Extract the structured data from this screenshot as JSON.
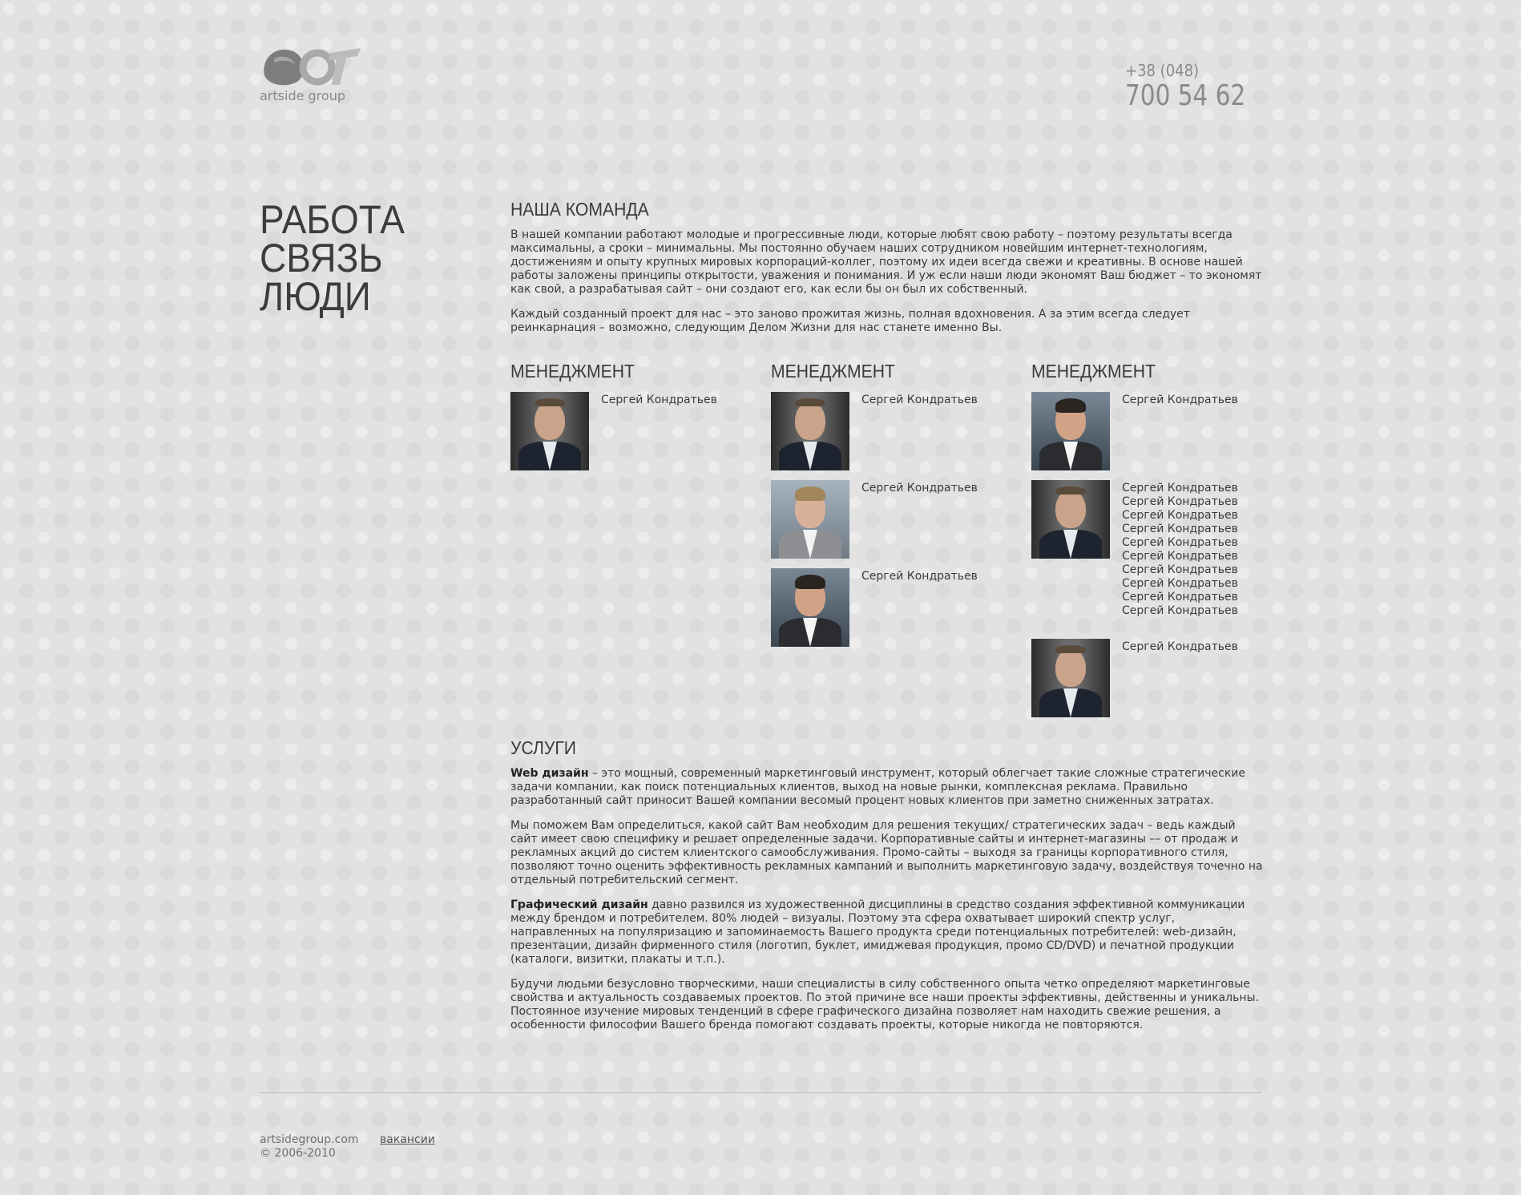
{
  "header": {
    "logo_text": "artside group",
    "phone_code": "+38 (048)",
    "phone_number": "700 54 62"
  },
  "slogan": [
    "РАБОТА",
    "СВЯЗЬ",
    "ЛЮДИ"
  ],
  "team_intro": {
    "title": "НАША КОМАНДА",
    "paragraphs": [
      "В нашей компании работают молодые и прогрессивные люди, которые любят свою работу – поэтому результаты всегда максимальны, а сроки – минимальны. Мы постоянно обучаем наших сотрудником новейшим интернет-технологиям, достижениям и опыту крупных мировых корпораций-коллег, поэтому их идеи всегда свежи и креативны. В основе нашей работы заложены принципы открытости, уважения и понимания. И уж если наши люди экономят Ваш бюджет – то экономят как свой, а разрабатывая сайт – они создают его, как если бы он был их собственный.",
      "Каждый созданный проект для нас – это заново прожитая жизнь, полная вдохновения. А за этим всегда следует реинкарнация – возможно, следующим Делом Жизни для нас станете именно Вы."
    ]
  },
  "team_columns": [
    {
      "title": "МЕНЕДЖМЕНТ",
      "people": [
        {
          "name": "Сергей Кондратьев",
          "photo": "man-bald-beard"
        }
      ]
    },
    {
      "title": "МЕНЕДЖМЕНТ",
      "people": [
        {
          "name": "Сергей Кондратьев",
          "photo": "man-bald-beard"
        },
        {
          "name": "Сергей Кондратьев",
          "photo": "man-blond"
        },
        {
          "name": "Сергей Кондратьев",
          "photo": "man-dark-hair"
        }
      ]
    },
    {
      "title": "МЕНЕДЖМЕНТ",
      "people": [
        {
          "name": "Сергей Кондратьев",
          "photo": "man-dark-hair"
        },
        {
          "name": "Сергей КондратьевСергей КондратьевСергей КондратьевСергей КондратьевСергей КондратьевСергей КондратьевСергей КондратьевСергей КондратьевСергей КондратьевСергей Кондратьев",
          "photo": "man-bald-beard"
        },
        {
          "name": "Сергей Кондратьев",
          "photo": "man-bald-beard"
        }
      ]
    }
  ],
  "services": {
    "title": "УСЛУГИ",
    "web_design_bold": "Web дизайн",
    "web_design_text": " – это мощный, современный маркетинговый инструмент, который облегчает такие сложные стратегические задачи компании, как поиск потенциальных клиентов, выход на новые рынки, комплексная реклама. Правильно разработанный сайт приносит Вашей компании весомый процент новых клиентов при заметно сниженных затратах.",
    "paragraph2": "Мы поможем Вам определиться, какой сайт Вам необходим для решения текущих/ стратегических задач – ведь каждый сайт имеет свою специфику и решает определенные задачи. Корпоративные сайты и интернет-магазины –– от продаж и рекламных акций до систем клиентского самообслуживания. Промо-сайты – выходя за границы корпоративного стиля, позволяют точно оценить эффективность рекламных кампаний и выполнить маркетинговую задачу, воздействуя точечно на отдельный потребительский сегмент.",
    "graphic_bold": "Графический дизайн",
    "graphic_text": " давно развился из художественной дисциплины в средство создания эффективной коммуникации между брендом и потребителем. 80% людей – визуалы. Поэтому эта сфера охватывает широкий спектр услуг, направленных на популяризацию и запоминаемость Вашего продукта среди потенциальных потребителей: web-дизайн, презентации, дизайн фирменного стиля (логотип, буклет, имиджевая продукция, промо CD/DVD) и печатной продукции (каталоги, визитки, плакаты и т.п.).",
    "paragraph4": "Будучи людьми безусловно творческими, наши специалисты в силу собственного опыта четко определяют маркетинговые свойства и актуальность создаваемых проектов. По этой причине все наши проекты эффективны, действенны и уникальны. Постоянное изучение мировых тенденций в сфере графического дизайна позволяет нам находить свежие решения, а особенности философии Вашего бренда помогают создавать проекты, которые никогда не повторяются."
  },
  "footer": {
    "site": "artsidegroup.com",
    "vacancies_link": "вакансии",
    "copyright": "© 2006-2010"
  }
}
